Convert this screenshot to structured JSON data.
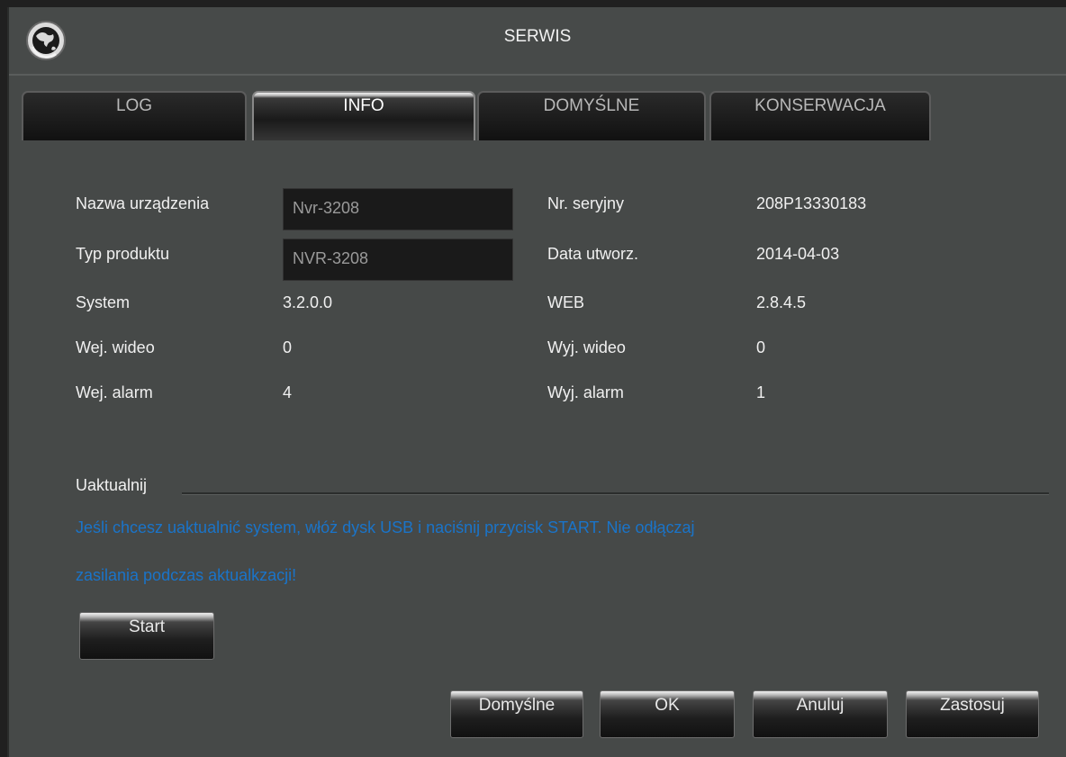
{
  "window": {
    "title": "SERWIS",
    "logo_icon": "globe-refresh-icon"
  },
  "tabs": [
    {
      "label": "LOG",
      "active": false
    },
    {
      "label": "INFO",
      "active": true
    },
    {
      "label": "DOMYŚLNE",
      "active": false
    },
    {
      "label": "KONSERWACJA",
      "active": false
    }
  ],
  "info": {
    "device_name": {
      "label": "Nazwa urządzenia",
      "value": "Nvr-3208"
    },
    "product_type": {
      "label": "Typ produktu",
      "value": "NVR-3208"
    },
    "system": {
      "label": "System",
      "value": "3.2.0.0"
    },
    "video_in": {
      "label": "Wej. wideo",
      "value": "0"
    },
    "alarm_in": {
      "label": "Wej. alarm",
      "value": "4"
    },
    "serial": {
      "label": "Nr. seryjny",
      "value": "208P13330183"
    },
    "created": {
      "label": "Data utworz.",
      "value": "2014-04-03"
    },
    "web": {
      "label": "WEB",
      "value": "2.8.4.5"
    },
    "video_out": {
      "label": "Wyj. wideo",
      "value": "0"
    },
    "alarm_out": {
      "label": "Wyj. alarm",
      "value": "1"
    }
  },
  "update": {
    "heading": "Uaktualnij",
    "message_line1": "Jeśli chcesz uaktualnić system, włóż dysk USB i naciśnij przycisk START. Nie odłączaj",
    "message_line2": "zasilania podczas aktualkzacji!",
    "start_label": "Start",
    "message_color": "#1a74c9"
  },
  "footer": {
    "default_label": "Domyślne",
    "ok_label": "OK",
    "cancel_label": "Anuluj",
    "apply_label": "Zastosuj"
  }
}
